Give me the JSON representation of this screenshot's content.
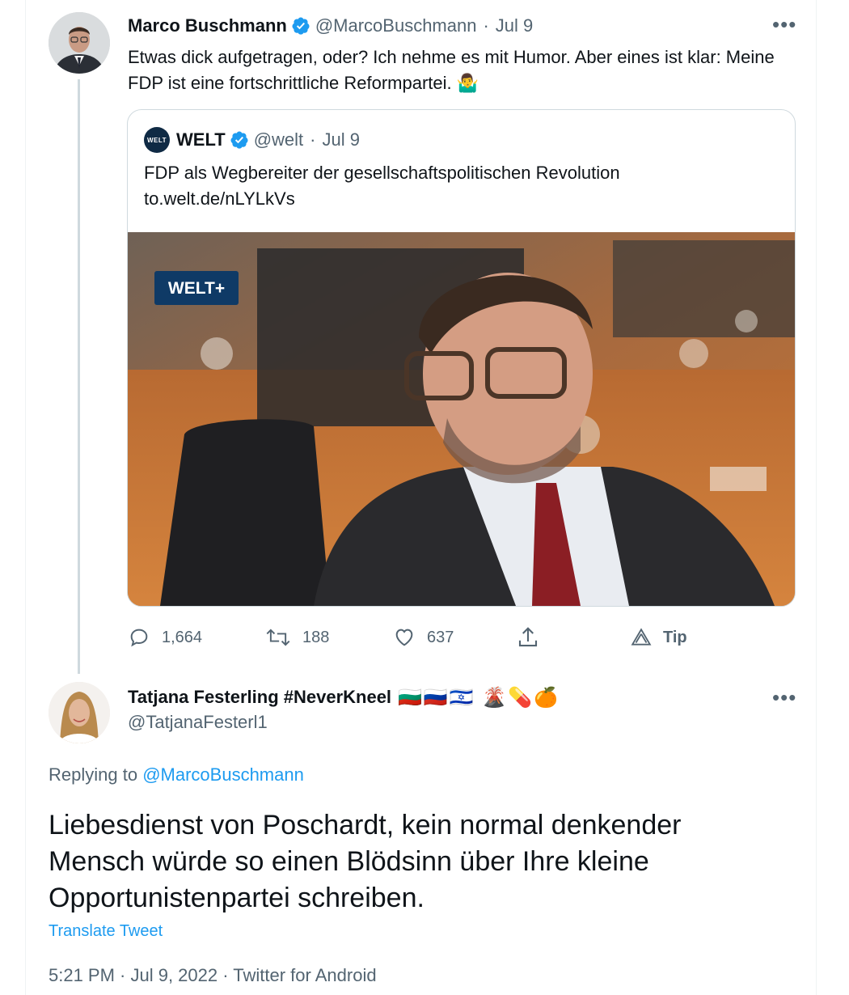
{
  "tweet": {
    "author_name": "Marco Buschmann",
    "author_handle": "@MarcoBuschmann",
    "date": "Jul 9",
    "text": "Etwas dick aufgetragen, oder? Ich nehme es mit Humor. Aber eines ist klar: Meine FDP ist eine fortschrittliche Reformpartei. 🤷‍♂️",
    "more": "•••"
  },
  "quote": {
    "logo_text": "WELT",
    "author_name": "WELT",
    "author_handle": "@welt",
    "date": "Jul 9",
    "text": "FDP als Wegbereiter der gesellschaftspolitischen Revolution",
    "link": "to.welt.de/nLYLkVs",
    "image_badge": "WELT+"
  },
  "actions": {
    "replies": "1,664",
    "retweets": "188",
    "likes": "637",
    "tip": "Tip"
  },
  "reply": {
    "author_name": "Tatjana Festerling #NeverKneel",
    "emojis": "🇧🇬🇷🇺🇮🇱 🌋💊🍊",
    "author_handle": "@TatjanaFesterl1",
    "replying_prefix": "Replying to",
    "replying_to": "@MarcoBuschmann",
    "text": "Liebesdienst von Poschardt, kein normal denkender Mensch würde so einen Blödsinn über Ihre kleine Opportunistenpartei schreiben.",
    "translate": "Translate Tweet",
    "timestamp": "5:21 PM · Jul 9, 2022 · Twitter for Android",
    "more": "•••"
  },
  "colors": {
    "accent": "#1d9bf0",
    "secondary_text": "#536471",
    "border": "#cfd9de"
  }
}
